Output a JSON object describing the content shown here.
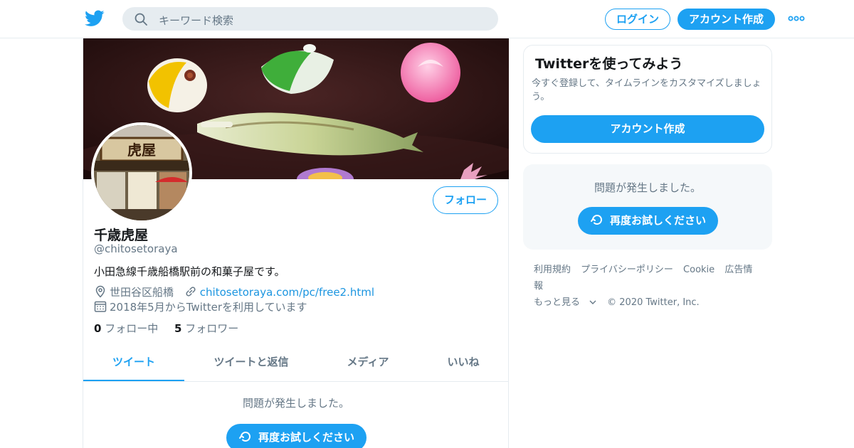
{
  "colors": {
    "accent": "#1da1f2",
    "link": "#1b95e0",
    "muted": "#657786",
    "text": "#14171a",
    "border": "#e6ecf0"
  },
  "topbar": {
    "logo_icon": "twitter-bird-icon",
    "search_placeholder": "キーワード検索",
    "login_label": "ログイン",
    "signup_label": "アカウント作成",
    "more_icon": "more-dots-icon"
  },
  "profile": {
    "display_name": "千歳虎屋",
    "handle": "@chitosetoraya",
    "bio": "小田急線千歳船橋駅前の和菓子屋です。",
    "location": "世田谷区船橋",
    "url": "chitosetoraya.com/pc/free2.html",
    "joined": "2018年5月からTwitterを利用しています",
    "following_count": "0",
    "following_label": "フォロー中",
    "followers_count": "5",
    "followers_label": "フォロワー",
    "follow_label": "フォロー",
    "avatar_sign_text": "虎屋"
  },
  "tabs": [
    {
      "label": "ツイート",
      "active": true
    },
    {
      "label": "ツイートと返信",
      "active": false
    },
    {
      "label": "メディア",
      "active": false
    },
    {
      "label": "いいね",
      "active": false
    }
  ],
  "timeline": {
    "error_text": "問題が発生しました。",
    "retry_label": "再度お試しください"
  },
  "sidebar": {
    "signup_card": {
      "title": "Twitterを使ってみよう",
      "description": "今すぐ登録して、タイムラインをカスタマイズしましょう。",
      "button_label": "アカウント作成"
    },
    "error_card": {
      "error_text": "問題が発生しました。",
      "retry_label": "再度お試しください"
    },
    "footer": {
      "links": [
        "利用規約",
        "プライバシーポリシー",
        "Cookie",
        "広告情報"
      ],
      "more_label": "もっと見る",
      "copyright": "© 2020 Twitter, Inc."
    }
  }
}
